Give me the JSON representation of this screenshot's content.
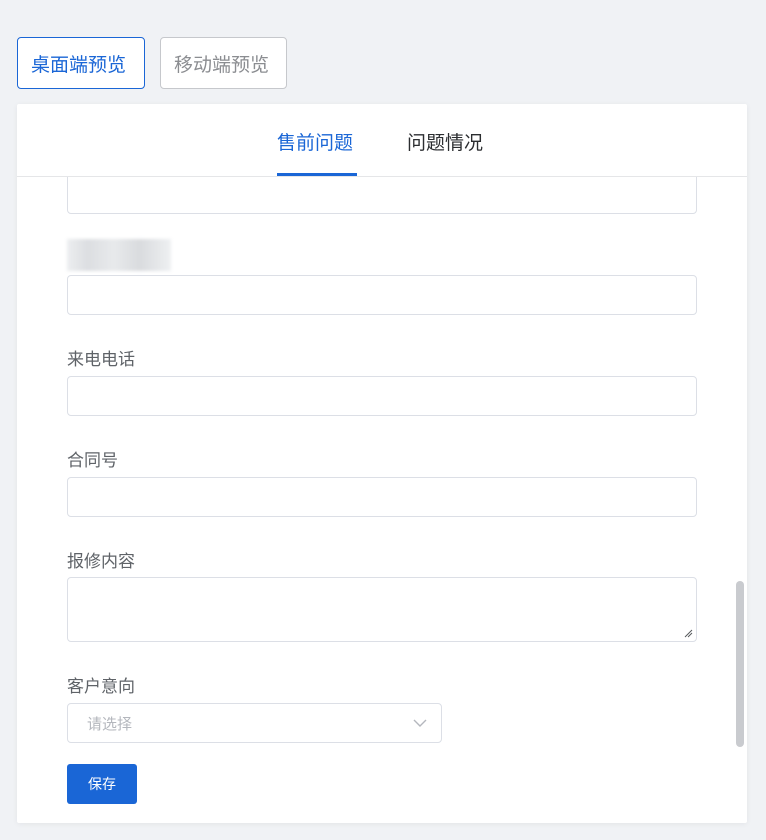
{
  "preview_buttons": {
    "desktop_label": "桌面端预览",
    "mobile_label": "移动端预览"
  },
  "tabs": [
    {
      "label": "售前问题",
      "active": true
    },
    {
      "label": "问题情况",
      "active": false
    }
  ],
  "form": {
    "fields": [
      {
        "label": "来电电话",
        "value": ""
      },
      {
        "label": "合同号",
        "value": ""
      },
      {
        "label": "报修内容",
        "value": ""
      }
    ],
    "customer_intent": {
      "label": "客户意向",
      "placeholder": "请选择"
    },
    "save_label": "保存"
  },
  "colors": {
    "accent": "#1a66d6",
    "border": "#dcdfe6",
    "label_text": "#5f6368"
  }
}
